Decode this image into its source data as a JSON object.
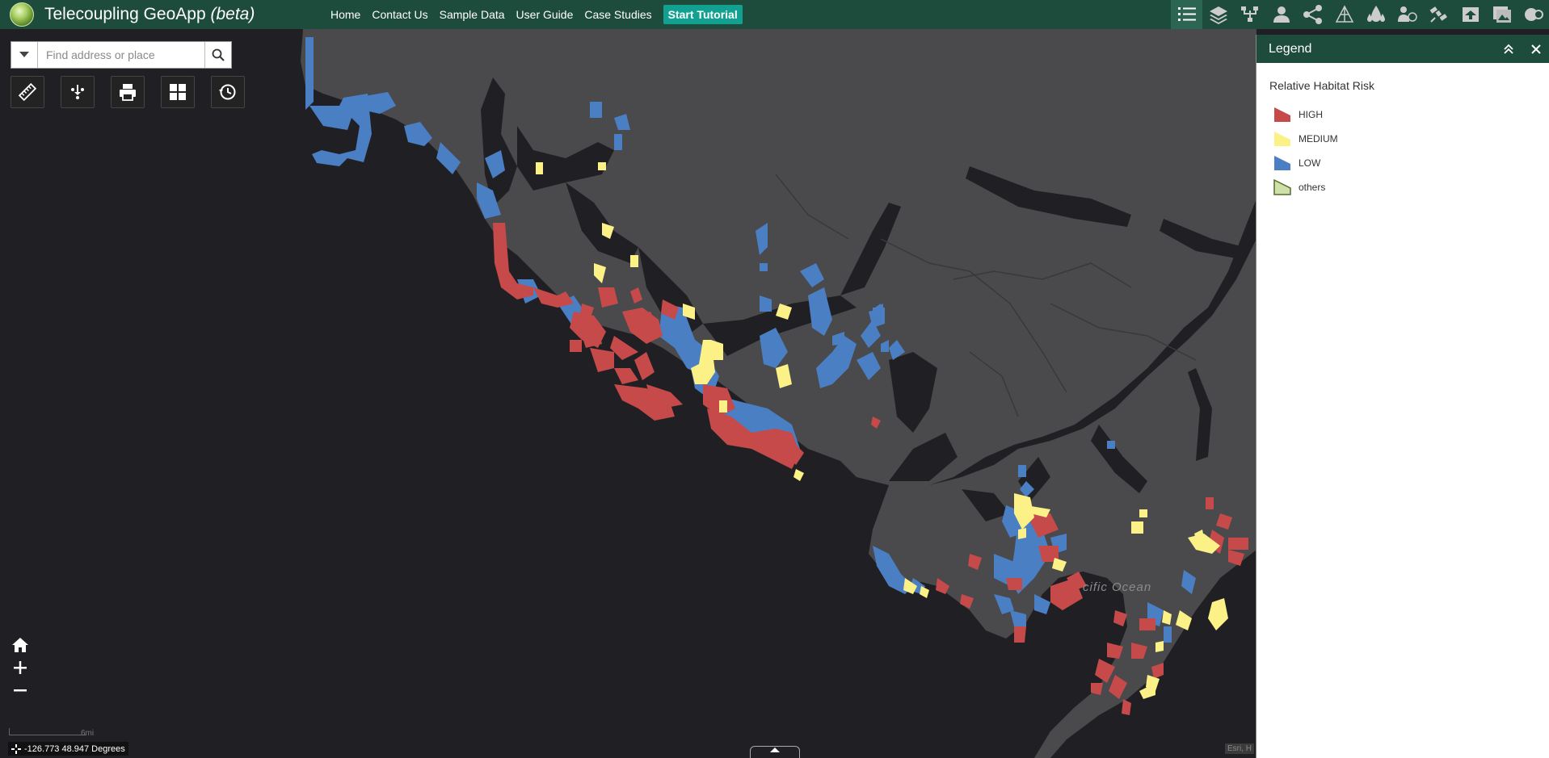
{
  "header": {
    "app_title": "Telecoupling GeoApp",
    "app_title_suffix": "(beta)",
    "nav": [
      "Home",
      "Contact Us",
      "Sample Data",
      "User Guide",
      "Case Studies"
    ],
    "tutorial_label": "Start Tutorial",
    "tools": [
      "legend-list-icon",
      "layers-icon",
      "telecoupling-tree-icon",
      "person-icon",
      "share-network-icon",
      "triangle-network-icon",
      "water-drops-icon",
      "money-person-icon",
      "satellite-icon",
      "upload-icon",
      "image-gallery-icon",
      "world-gear-icon"
    ]
  },
  "search": {
    "placeholder": "Find address or place"
  },
  "map_tools": [
    "ruler-icon",
    "select-points-icon",
    "print-icon",
    "basemap-grid-icon",
    "history-icon"
  ],
  "map": {
    "label_ocean": "cific Ocean",
    "scale_label": "6mi",
    "coordinates": "-126.773 48.947 Degrees",
    "attribution": "Esri, H"
  },
  "legend": {
    "title": "Legend",
    "layer_title": "Relative Habitat Risk",
    "items": [
      {
        "label": "HIGH",
        "color": "#c64a4a"
      },
      {
        "label": "MEDIUM",
        "color": "#fbf187"
      },
      {
        "label": "LOW",
        "color": "#4a7fc4"
      },
      {
        "label": "others",
        "color": "#cfe0a8"
      }
    ]
  },
  "colors": {
    "header": "#1d4c3c",
    "land": "#4a4a4d",
    "water": "#202024",
    "high": "#c64a4a",
    "medium": "#fbf187",
    "low": "#4a7fc4"
  }
}
